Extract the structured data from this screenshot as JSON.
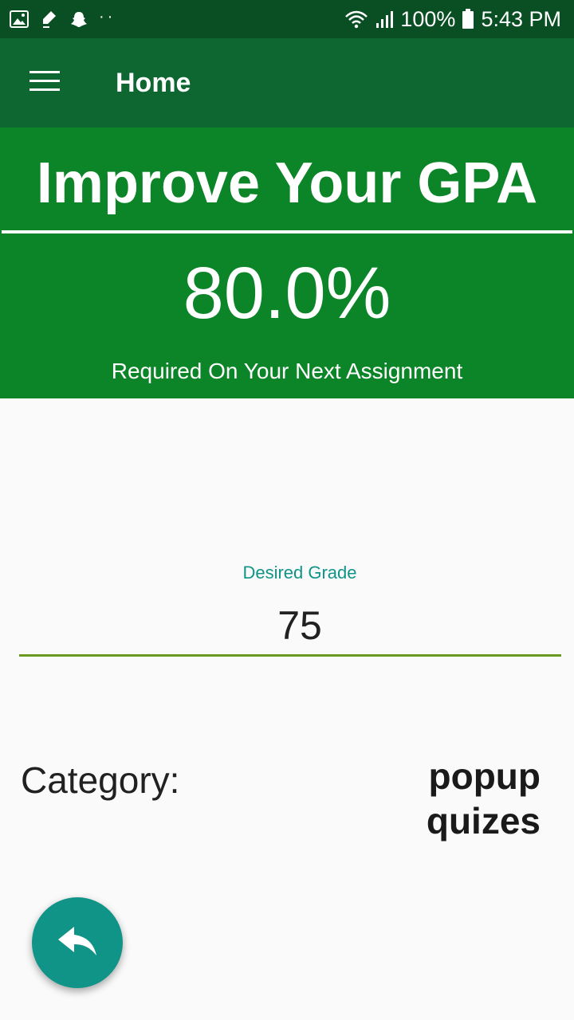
{
  "status_bar": {
    "battery": "100%",
    "time": "5:43 PM",
    "icons_left": [
      "gallery-icon",
      "cleaner-icon",
      "snapchat-icon",
      "more-dots-icon"
    ],
    "icons_right": [
      "wifi-icon",
      "signal-icon",
      "battery-icon"
    ]
  },
  "app_bar": {
    "title": "Home",
    "menu_icon": "hamburger-menu-icon"
  },
  "hero": {
    "title": "Improve Your GPA",
    "percent": "80.0%",
    "subtitle": "Required On Your Next Assignment"
  },
  "desired_grade": {
    "label": "Desired Grade",
    "value": "75"
  },
  "category": {
    "label": "Category:",
    "value_line1": "popup",
    "value_line2": "quizes"
  },
  "fab": {
    "icon": "reply-arrow-icon"
  },
  "colors": {
    "status_bar": "#0a4f23",
    "app_bar": "#0e6630",
    "hero": "#0c8428",
    "accent": "#119488",
    "underline": "#6a9a1f"
  }
}
